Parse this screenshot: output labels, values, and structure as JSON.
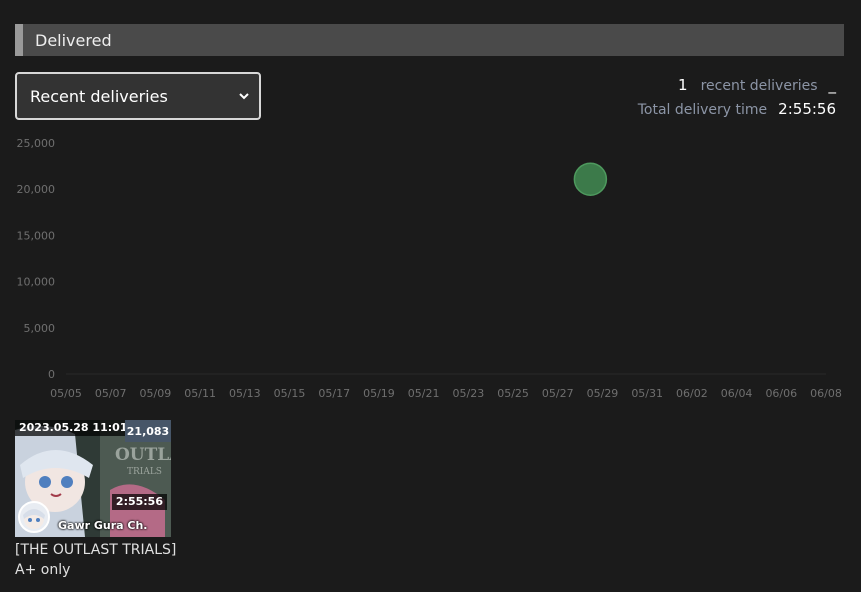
{
  "section": {
    "title": "Delivered"
  },
  "filter": {
    "selected": "Recent deliveries"
  },
  "stats": {
    "count": "1",
    "count_label": "recent deliveries",
    "count_suffix": "_",
    "total_label": "Total delivery time",
    "total_value": "2:55:56"
  },
  "chart_data": {
    "type": "scatter",
    "ylim": [
      0,
      25000
    ],
    "yticks": [
      "25,000",
      "20,000",
      "15,000",
      "10,000",
      "5,000",
      "0"
    ],
    "xticks": [
      "05/05",
      "05/07",
      "05/09",
      "05/11",
      "05/13",
      "05/15",
      "05/17",
      "05/19",
      "05/21",
      "05/23",
      "05/25",
      "05/27",
      "05/29",
      "05/31",
      "06/02",
      "06/04",
      "06/06",
      "06/08"
    ],
    "xrange": [
      "2023-05-05",
      "2023-06-08"
    ],
    "points": [
      {
        "x": "2023-05-28 11:01",
        "y": 21083
      }
    ],
    "point_color": "#3c7a4a",
    "grid": false
  },
  "videos": [
    {
      "datetime": "2023.05.28 11:01",
      "views": "21,083",
      "duration": "2:55:56",
      "channel": "Gawr Gura Ch.",
      "title": "[THE OUTLAST TRIALS]",
      "subtitle": "A+ only"
    }
  ]
}
